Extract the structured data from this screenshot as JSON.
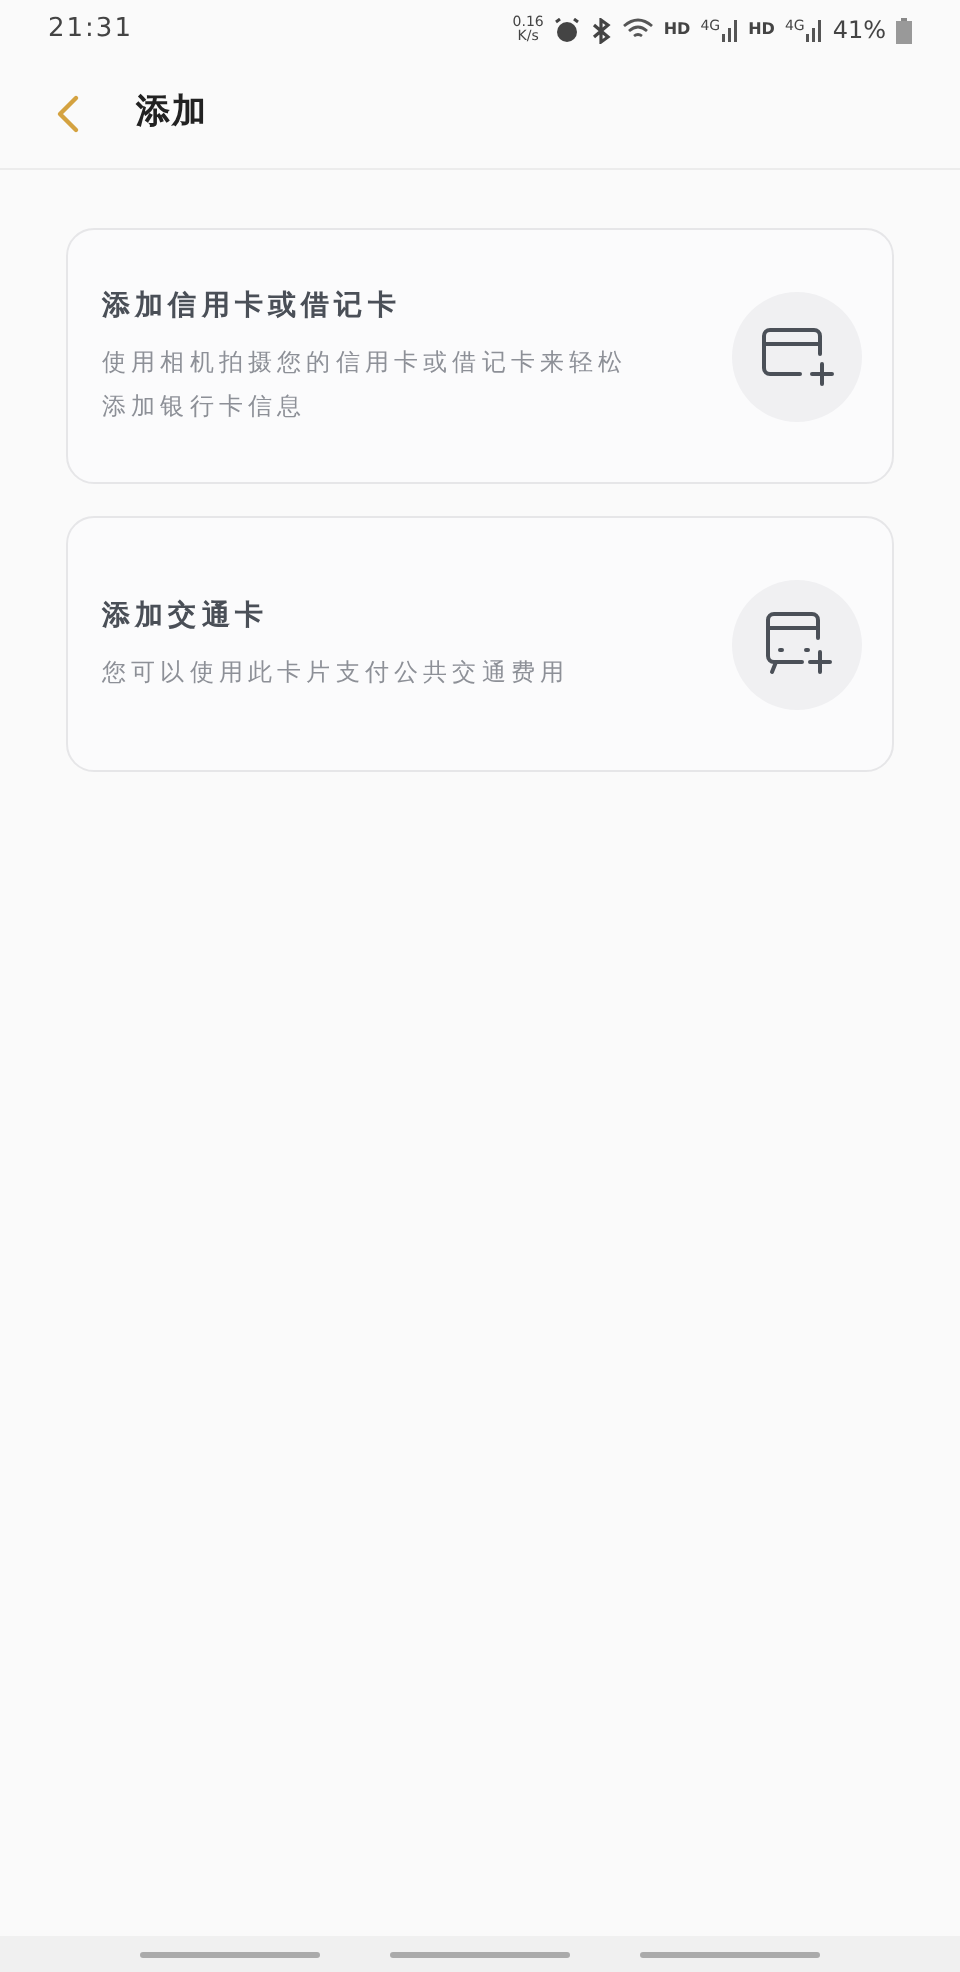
{
  "status_bar": {
    "time": "21:31",
    "speed_value": "0.16",
    "speed_unit": "K/s",
    "sim_1_label": "HD",
    "sim_1_network": "4G",
    "sim_2_label": "HD",
    "sim_2_network": "4G",
    "battery": "41%"
  },
  "header": {
    "title": "添加"
  },
  "options": [
    {
      "kind": "bank",
      "title": "添加信用卡或借记卡",
      "description": "使用相机拍摄您的信用卡或借记卡来轻松添加银行卡信息"
    },
    {
      "kind": "transit",
      "title": "添加交通卡",
      "description": "您可以使用此卡片支付公共交通费用"
    }
  ]
}
